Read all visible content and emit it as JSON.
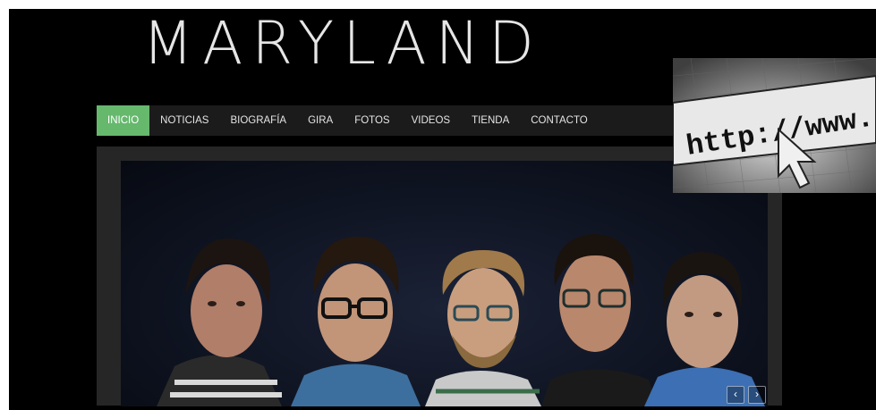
{
  "site": {
    "title": "MARYLAND"
  },
  "nav": {
    "items": [
      {
        "label": "INICIO",
        "active": true
      },
      {
        "label": "NOTICIAS",
        "active": false
      },
      {
        "label": "BIOGRAFÍA",
        "active": false
      },
      {
        "label": "GIRA",
        "active": false
      },
      {
        "label": "FOTOS",
        "active": false
      },
      {
        "label": "VIDEOS",
        "active": false
      },
      {
        "label": "TIENDA",
        "active": false
      },
      {
        "label": "CONTACTO",
        "active": false
      }
    ]
  },
  "slider": {
    "prev_icon": "chevron-left-icon",
    "next_icon": "chevron-right-icon",
    "prev_glyph": "‹",
    "next_glyph": "›"
  },
  "overlay": {
    "text": "http://www."
  },
  "colors": {
    "background": "#000000",
    "nav_active": "#66b86d",
    "nav_bar": "#1b1b1b",
    "title": "#e6e6e6"
  }
}
